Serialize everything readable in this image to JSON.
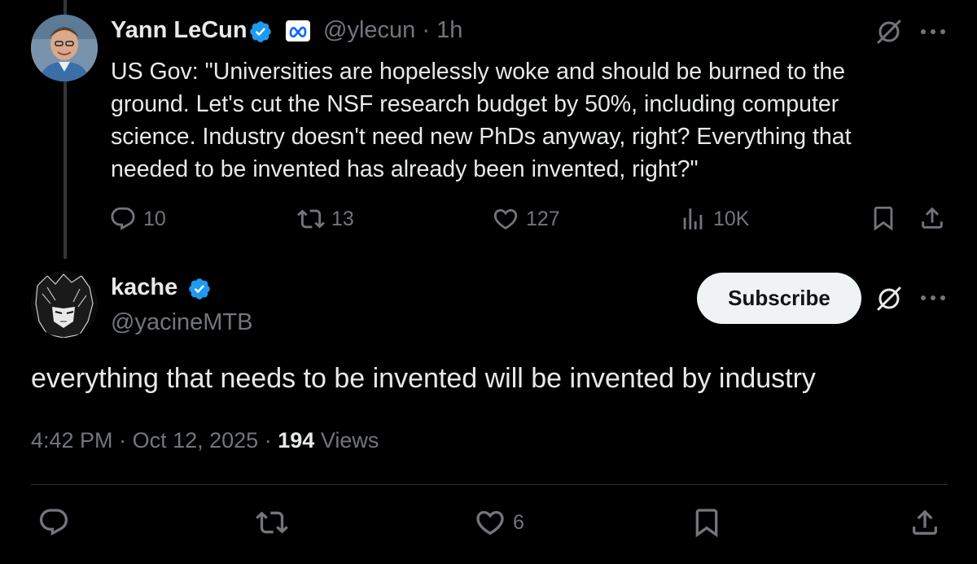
{
  "parent_tweet": {
    "author_name": "Yann LeCun",
    "handle": "@ylecun",
    "separator": "·",
    "time": "1h",
    "text": "US Gov: \"Universities are hopelessly woke and should be burned to the ground. Let's cut the NSF research budget by 50%, including computer science. Industry doesn't need new PhDs anyway, right? Everything that needed to be invented has already been invented, right?\"",
    "reply_count": "10",
    "retweet_count": "13",
    "like_count": "127",
    "view_count": "10K"
  },
  "main_tweet": {
    "author_name": "kache",
    "handle": "@yacineMTB",
    "subscribe_label": "Subscribe",
    "text": "everything that needs to be invented will be invented by industry",
    "time": "4:42 PM",
    "date": "Oct 12, 2025",
    "views_count": "194",
    "views_label": "Views",
    "like_count": "6"
  },
  "colors": {
    "background": "#000000",
    "text_primary": "#e7e9ea",
    "text_secondary": "#71767b",
    "verified_blue": "#1d9bf0",
    "divider": "#2f3336"
  },
  "icons": [
    "verified-badge-icon",
    "meta-affiliate-icon",
    "grok-icon",
    "more-icon",
    "reply-icon",
    "retweet-icon",
    "like-icon",
    "views-icon",
    "bookmark-icon",
    "share-icon"
  ]
}
